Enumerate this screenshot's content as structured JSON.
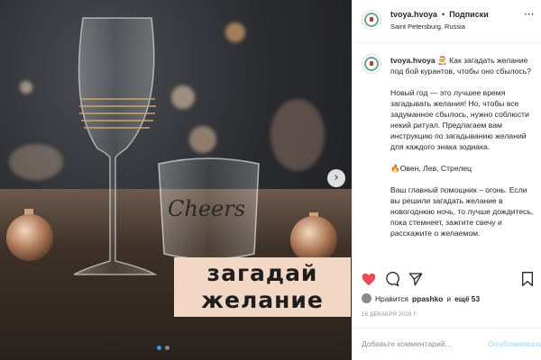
{
  "photo": {
    "caption_line1": "загадай",
    "caption_line2": "желание",
    "glass_text": "Cheers",
    "next_arrow_glyph": "›",
    "slides_total": 2,
    "slide_active": 1
  },
  "header": {
    "username": "tvoya.hvoya",
    "separator": "•",
    "follow_label": "Подписки",
    "location": "Saint Petersburg, Russia",
    "more_glyph": "···"
  },
  "post": {
    "username": "tvoya.hvoya",
    "paragraphs": [
      "🧑‍🎄 Как загадать желание под бой курантов, чтобы оно сбылось?",
      "Новый год — это лучшее время загадывать желания! Но, чтобы все задуманное сбылось, нужно соблюсти некий ритуал. Предлагаем вам инструкцию по загадыванию желаний для каждого знака зодиака.",
      "🔥Овен, Лев, Стрелец",
      "Ваш главный помощник – огонь. Если вы решили загадать желание в новогоднюю ночь, то лучше дождитесь, пока стемнеет, зажгите свечу и расскажите о желаемом."
    ]
  },
  "actions": {
    "like_icon": "heart-icon",
    "comment_icon": "comment-icon",
    "share_icon": "share-icon",
    "save_icon": "bookmark-icon"
  },
  "likes": {
    "prefix": "Нравится",
    "user": "ppashko",
    "middle": "и",
    "rest": "ещё 53"
  },
  "date": "16 ДЕКАБРЯ 2019 Г.",
  "comment": {
    "placeholder": "Добавьте комментарий...",
    "publish_label": "Опубликовать"
  },
  "colors": {
    "like_red": "#ed4956",
    "link_blue": "#3897f0",
    "caption_bg": "#f1d7c4"
  }
}
